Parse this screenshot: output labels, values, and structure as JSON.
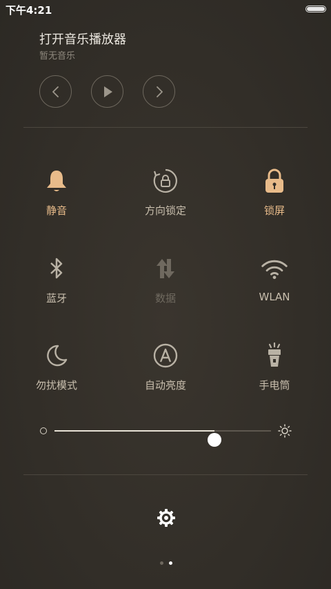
{
  "status_bar": {
    "time": "下午4:21",
    "battery_level": 1.0
  },
  "music": {
    "title": "打开音乐播放器",
    "subtitle": "暂无音乐",
    "controls": [
      "chevron-left-icon",
      "play-icon",
      "chevron-right-icon"
    ]
  },
  "toggles": [
    {
      "label": "静音",
      "icon": "bell-icon",
      "state": "on"
    },
    {
      "label": "方向锁定",
      "icon": "rotation-lock-icon",
      "state": "off"
    },
    {
      "label": "锁屏",
      "icon": "lock-icon",
      "state": "on"
    },
    {
      "label": "蓝牙",
      "icon": "bluetooth-icon",
      "state": "off"
    },
    {
      "label": "数据",
      "icon": "data-sync-icon",
      "state": "disabled"
    },
    {
      "label": "WLAN",
      "icon": "wifi-icon",
      "state": "off"
    },
    {
      "label": "勿扰模式",
      "icon": "moon-icon",
      "state": "off"
    },
    {
      "label": "自动亮度",
      "icon": "auto-brightness-icon",
      "state": "off"
    },
    {
      "label": "手电筒",
      "icon": "flashlight-icon",
      "state": "off"
    }
  ],
  "brightness": {
    "level": 0.74
  },
  "settings_icon": "gear-icon",
  "pager": {
    "pages": 2,
    "current": 2
  },
  "colors": {
    "background": "#34302a",
    "active_accent": "#e8bb8a",
    "label": "#c9bfae",
    "disabled": "#6f695f"
  }
}
